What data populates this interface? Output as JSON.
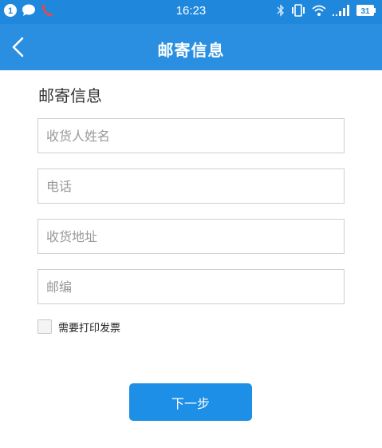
{
  "status_bar": {
    "notification_count": "1",
    "time": "16:23",
    "battery": "31",
    "icons": [
      "notification-badge-icon",
      "chat-bubble-icon",
      "missed-call-icon",
      "bluetooth-icon",
      "vibrate-icon",
      "wifi-icon",
      "signal-icon",
      "battery-icon"
    ]
  },
  "header": {
    "back_icon": "chevron-left-icon",
    "title": "邮寄信息"
  },
  "form": {
    "section_title": "邮寄信息",
    "recipient_name": {
      "placeholder": "收货人姓名",
      "value": ""
    },
    "phone": {
      "placeholder": "电话",
      "value": ""
    },
    "address": {
      "placeholder": "收货地址",
      "value": ""
    },
    "postcode": {
      "placeholder": "邮编",
      "value": ""
    },
    "invoice_checkbox": {
      "label": "需要打印发票",
      "checked": false
    },
    "next_button": "下一步"
  },
  "colors": {
    "header_blue": "#2a8fe0",
    "status_blue": "#1f88dc",
    "button_blue": "#1e8fe6",
    "border_gray": "#cfcfcf"
  }
}
